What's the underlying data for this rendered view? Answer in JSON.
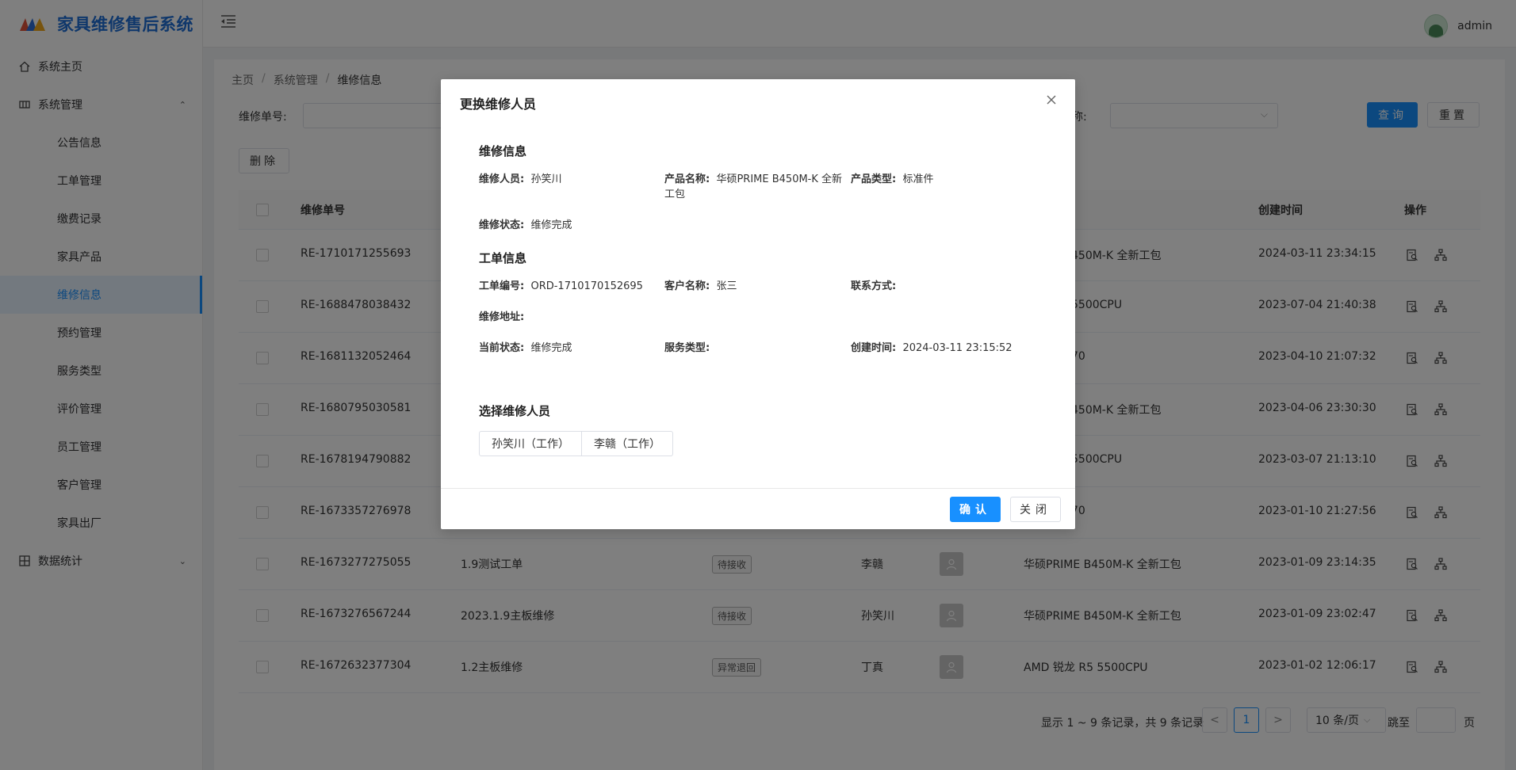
{
  "app": {
    "title": "家具维修售后系统"
  },
  "header": {
    "user_name": "admin"
  },
  "sidebar": {
    "home": "系统主页",
    "system_manage": "系统管理",
    "sub_items": [
      "公告信息",
      "工单管理",
      "缴费记录",
      "家具产品",
      "维修信息",
      "预约管理",
      "服务类型",
      "评价管理",
      "员工管理",
      "客户管理",
      "家具出厂"
    ],
    "stats": "数据统计"
  },
  "breadcrumb": [
    "主页",
    "系统管理",
    "维修信息"
  ],
  "search": {
    "no_label": "维修单号:",
    "name_label_suffix": "称:",
    "query_btn": "查询",
    "reset_btn": "重置"
  },
  "toolbar": {
    "delete_btn": "删除"
  },
  "table": {
    "headers": {
      "no": "维修单号",
      "created": "创建时间",
      "ops": "操作"
    },
    "rows": [
      {
        "no": "RE-1710171255693",
        "product": "450M-K 全新工包",
        "created": "2024-03-11 23:34:15"
      },
      {
        "no": "RE-1688478038432",
        "product": "5500CPU",
        "created": "2023-07-04 21:40:38"
      },
      {
        "no": "RE-1681132052464",
        "product": "70",
        "created": "2023-04-10 21:07:32"
      },
      {
        "no": "RE-1680795030581",
        "product": "450M-K 全新工包",
        "created": "2023-04-06 23:30:30"
      },
      {
        "no": "RE-1678194790882",
        "product": "5500CPU",
        "created": "2023-03-07 21:13:10"
      },
      {
        "no": "RE-1673357276978",
        "product": "70",
        "created": "2023-01-10 21:27:56"
      },
      {
        "no": "RE-1673277275055",
        "title": "1.9测试工单",
        "status": "待接收",
        "worker": "李赣",
        "product": "华硕PRIME B450M-K 全新工包",
        "created": "2023-01-09 23:14:35"
      },
      {
        "no": "RE-1673276567244",
        "title": "2023.1.9主板维修",
        "status": "待接收",
        "worker": "孙笑川",
        "product": "华硕PRIME B450M-K 全新工包",
        "created": "2023-01-09 23:02:47"
      },
      {
        "no": "RE-1672632377304",
        "title": "1.2主板维修",
        "status": "异常退回",
        "worker": "丁真",
        "product": "AMD 锐龙 R5 5500CPU",
        "created": "2023-01-02 12:06:17"
      }
    ]
  },
  "pager": {
    "summary": "显示 1 ~ 9 条记录，共 9 条记录",
    "current": "1",
    "size": "10 条/页",
    "jump": "跳至",
    "page": "页",
    "prev": "<",
    "next": ">"
  },
  "modal": {
    "title": "更换维修人员",
    "repair_section": "维修信息",
    "worker_label": "维修人员:",
    "worker_value": "孙笑川",
    "product_label": "产品名称:",
    "product_value_l1": "华硕PRIME B450M-K 全新",
    "product_value_l2": "工包",
    "ptype_label": "产品类型:",
    "ptype_value": "标准件",
    "rstatus_label": "维修状态:",
    "rstatus_value": "维修完成",
    "order_section": "工单信息",
    "order_no_label": "工单编号:",
    "order_no_value": "ORD-1710170152695",
    "customer_label": "客户名称:",
    "customer_value": "张三",
    "contact_label": "联系方式:",
    "address_label": "维修地址:",
    "cur_status_label": "当前状态:",
    "cur_status_value": "维修完成",
    "service_label": "服务类型:",
    "created_label": "创建时间:",
    "created_value": "2024-03-11 23:15:52",
    "choose_section": "选择维修人员",
    "options": [
      "孙笑川（工作）",
      "李赣（工作）"
    ],
    "confirm": "确认",
    "close": "关闭"
  }
}
